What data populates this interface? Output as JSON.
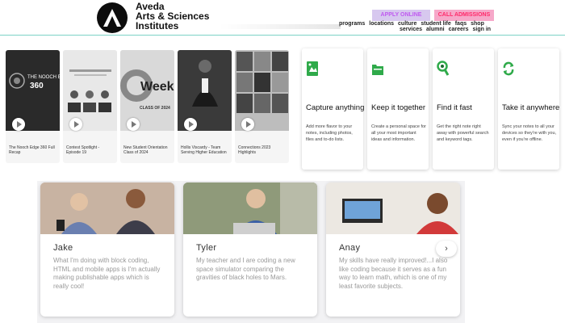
{
  "header": {
    "brand_line1": "Aveda",
    "brand_line2": "Arts & Sciences",
    "brand_line3": "Institutes",
    "apply_label": "APPLY ONLINE",
    "call_label": "CALL ADMISSIONS",
    "nav_row1": [
      "programs",
      "locations",
      "culture",
      "student life",
      "faqs",
      "shop"
    ],
    "nav_row2": [
      "services",
      "alumni",
      "careers",
      "sign in"
    ]
  },
  "videos": [
    {
      "caption": "The Nooch Edge 360 Full Recap"
    },
    {
      "caption": "Contest Spotlight - Episode 19"
    },
    {
      "caption": "New Student Orientation Class of 2024"
    },
    {
      "caption": "Hollis Viscardy - Team Serving Higher Education"
    },
    {
      "caption": "Connections 2023 Highlights"
    }
  ],
  "features": [
    {
      "title": "Capture anything",
      "desc": "Add more flavor to your notes, including photos, files and to-do lists.",
      "icon": "note-capture-icon",
      "color": "#2faa4a"
    },
    {
      "title": "Keep it together",
      "desc": "Create a personal space for all your most important ideas and information.",
      "icon": "folder-icon",
      "color": "#2faa4a"
    },
    {
      "title": "Find it fast",
      "desc": "Get the right note right away with powerful search and keyword tags.",
      "icon": "search-icon",
      "color": "#2faa4a"
    },
    {
      "title": "Take it anywhere",
      "desc": "Sync your notes to all your devices so they're with you, even if you're offline.",
      "icon": "sync-icon",
      "color": "#2faa4a"
    }
  ],
  "testimonials": [
    {
      "name": "Jake",
      "quote": "What I'm doing with block coding, HTML and mobile apps is I'm actually making publishable apps which is really cool!"
    },
    {
      "name": "Tyler",
      "quote": "My teacher and I are coding a new space simulator comparing the gravities of black holes to Mars."
    },
    {
      "name": "Anay",
      "quote": "My skills have really improved!...I also like coding because it serves as a fun way to learn math, which is one of my least favorite subjects."
    }
  ],
  "next_arrow": "›",
  "colors": {
    "accent_teal": "#7dd3c7",
    "apply_text": "#c05af0",
    "call_text": "#ff2a6a"
  }
}
